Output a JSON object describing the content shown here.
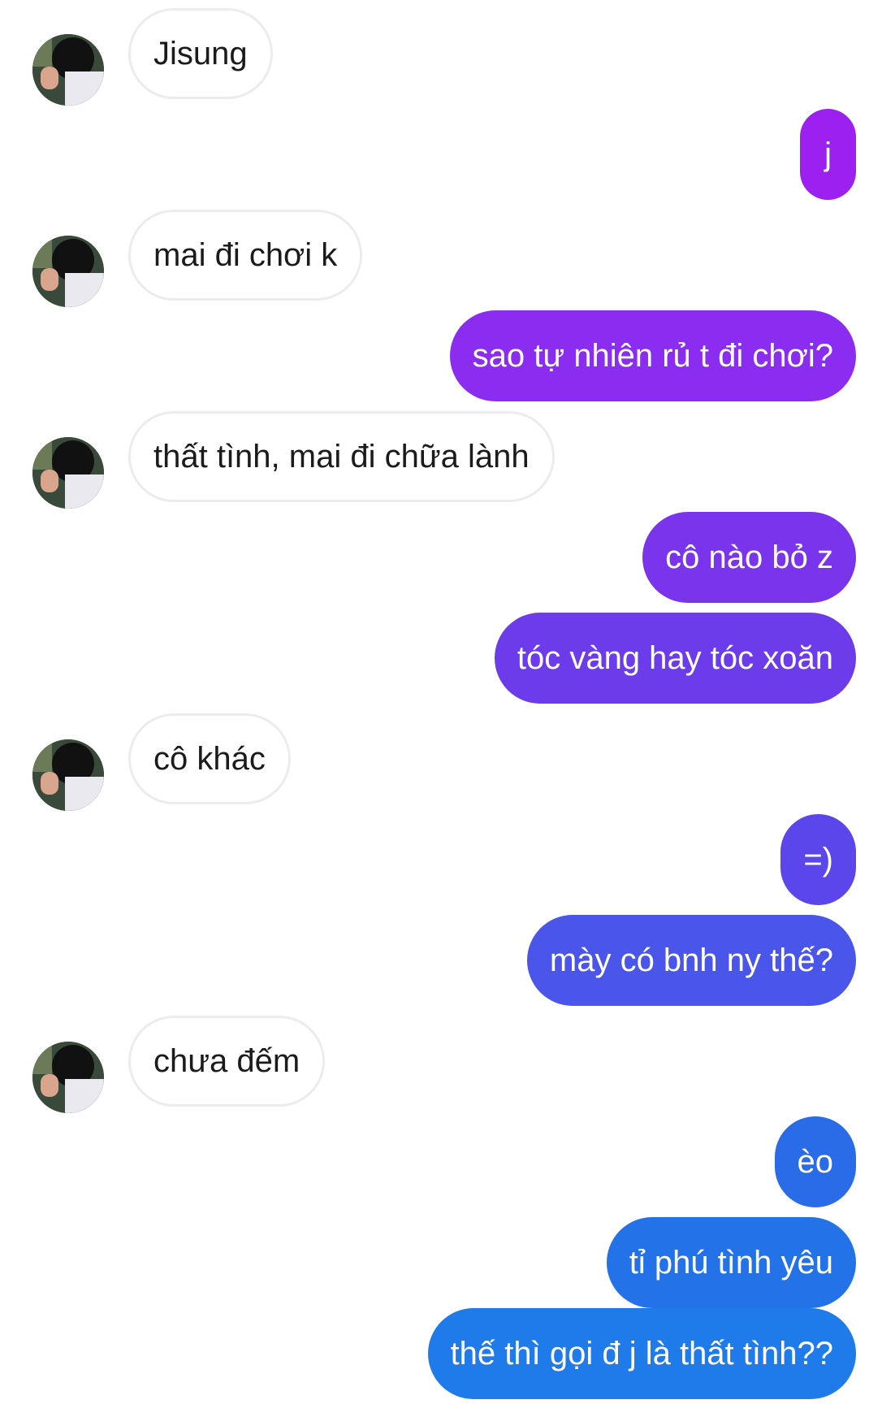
{
  "conversation": {
    "contact_avatar": "profile-photo",
    "messages": [
      {
        "sender": "contact",
        "text": "Jisung"
      },
      {
        "sender": "me",
        "text": "j",
        "color": "#9c20f0"
      },
      {
        "sender": "contact",
        "text": "mai đi chơi k"
      },
      {
        "sender": "me",
        "text": "sao tự nhiên rủ t đi chơi?",
        "color": "#8b2df0"
      },
      {
        "sender": "contact",
        "text": "thất tình, mai đi chữa lành"
      },
      {
        "sender": "me",
        "text": "cô nào bỏ z",
        "color": "#7a35ec"
      },
      {
        "sender": "me",
        "text": "tóc vàng hay tóc xoăn",
        "color": "#6c3ceb"
      },
      {
        "sender": "contact",
        "text": "cô khác"
      },
      {
        "sender": "me",
        "text": "=)",
        "color": "#5a46ea"
      },
      {
        "sender": "me",
        "text": "mày có bnh ny thế?",
        "color": "#4a55e9"
      },
      {
        "sender": "contact",
        "text": "chưa đếm"
      },
      {
        "sender": "me",
        "text": "èo",
        "color": "#2a6be8"
      },
      {
        "sender": "me",
        "text": "tỉ phú tình yêu",
        "color": "#2472e8"
      },
      {
        "sender": "me",
        "text": "thế thì gọi đ j là thất tình??",
        "color": "#1f7aea"
      }
    ]
  }
}
